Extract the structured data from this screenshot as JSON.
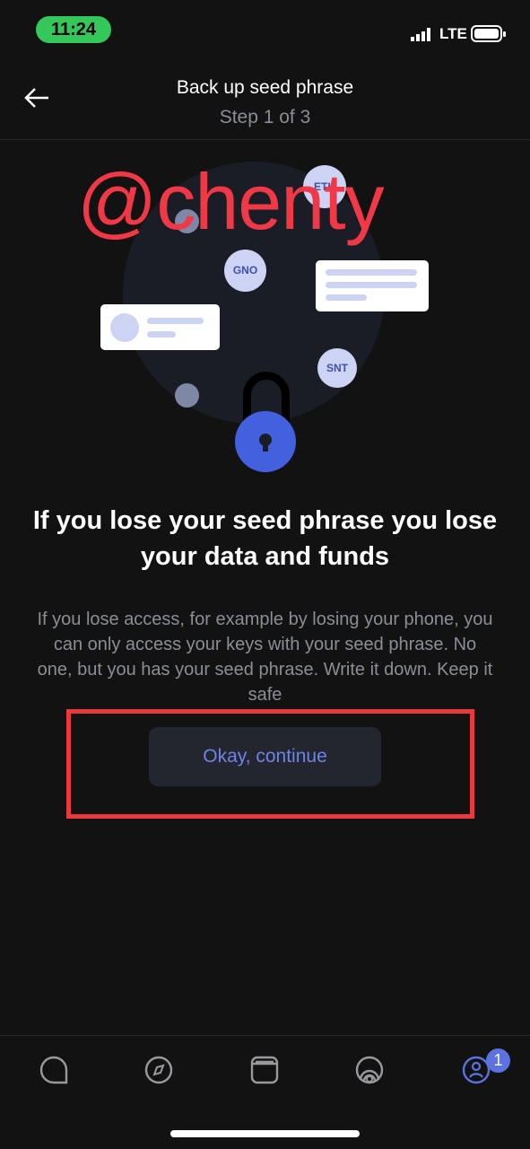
{
  "status_bar": {
    "time": "11:24",
    "network": "LTE"
  },
  "header": {
    "title": "Back up seed phrase",
    "subtitle": "Step 1 of 3",
    "back_icon": "arrow-left-icon"
  },
  "illustration": {
    "coins": [
      "ETH",
      "GNO",
      "SNT"
    ],
    "watermark": "@chenty"
  },
  "content": {
    "heading": "If you lose your seed phrase you lose your data and funds",
    "body": "If you lose access, for example by losing your phone, you can only access your keys with your seed phrase. No one, but you has your seed phrase. Write it down. Keep it safe"
  },
  "actions": {
    "continue_label": "Okay, continue"
  },
  "tab_bar": {
    "items": [
      {
        "icon": "chat-icon"
      },
      {
        "icon": "compass-icon"
      },
      {
        "icon": "wallet-icon"
      },
      {
        "icon": "status-icon"
      },
      {
        "icon": "profile-icon",
        "badge": "1"
      }
    ]
  },
  "colors": {
    "accent": "#4360df",
    "annotation": "#e8393c"
  }
}
